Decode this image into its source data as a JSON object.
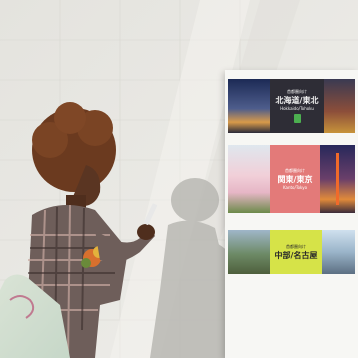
{
  "image": {
    "description_colors": {
      "wall": "#e9e8e3",
      "poster_frame": "#f7f7f4",
      "hokkaido_label_bg": "#2e2d36",
      "kanto_label_bg": "#e37a79",
      "chubu_label_bg": "#d6e348"
    }
  },
  "posters": [
    {
      "tag": "首都圏向け",
      "title": "北海道/東北",
      "romaji": "Hokkaido/Tohoku"
    },
    {
      "tag": "首都圏向け",
      "title": "関東/東京",
      "romaji": "Kanto/Tokyo"
    },
    {
      "tag": "首都圏向け",
      "title": "中部/名古屋",
      "romaji": ""
    }
  ]
}
